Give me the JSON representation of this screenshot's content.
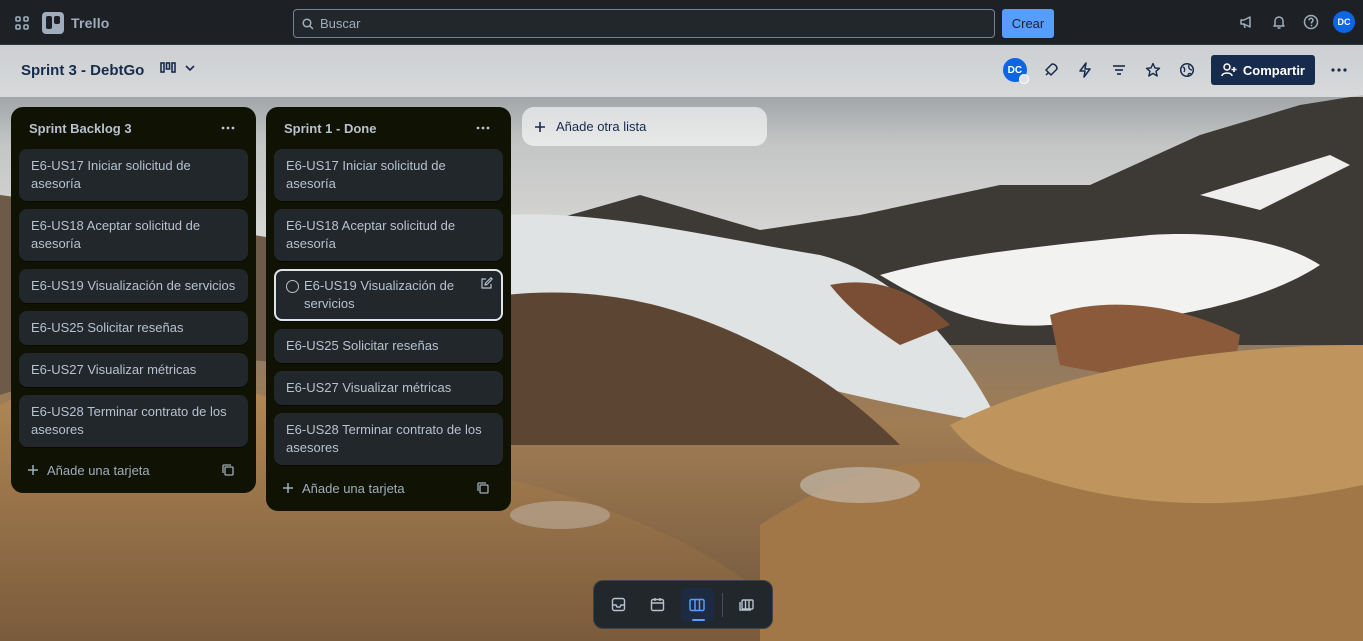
{
  "topbar": {
    "app_name": "Trello",
    "search_placeholder": "Buscar",
    "create_label": "Crear",
    "user_initials": "DC",
    "icons": [
      "apps-grid-icon",
      "megaphone-icon",
      "bell-icon",
      "help-icon"
    ]
  },
  "board": {
    "title": "Sprint 3 - DebtGo",
    "member_initials": "DC",
    "share_label": "Compartir",
    "icons": [
      "board-view-icon",
      "chevron-down-icon",
      "rocket-icon",
      "lightning-icon",
      "filter-icon",
      "star-icon",
      "globe-icon",
      "more-icon"
    ]
  },
  "lists": [
    {
      "title": "Sprint Backlog 3",
      "cards": [
        "E6-US17 Iniciar solicitud de asesoría",
        "E6-US18 Aceptar solicitud de asesoría",
        "E6-US19 Visualización de servicios",
        "E6-US25 Solicitar reseñas",
        "E6-US27 Visualizar métricas",
        "E6-US28 Terminar contrato de los asesores"
      ],
      "add_card_label": "Añade una tarjeta"
    },
    {
      "title": "Sprint 1 - Done",
      "cards": [
        "E6-US17 Iniciar solicitud de asesoría",
        "E6-US18 Aceptar solicitud de asesoría",
        "E6-US19 Visualización de servicios",
        "E6-US25 Solicitar reseñas",
        "E6-US27 Visualizar métricas",
        "E6-US28 Terminar contrato de los asesores"
      ],
      "add_card_label": "Añade una tarjeta"
    }
  ],
  "add_list_label": "Añade otra lista",
  "switcher": {
    "items": [
      "inbox-icon",
      "calendar-icon",
      "board-icon",
      "switch-boards-icon"
    ],
    "active": "board-icon"
  },
  "colors": {
    "accent": "#579dff",
    "topbar": "#1d2125",
    "list_bg": "#101204",
    "card_bg": "#22272b",
    "share_bg": "#172b4d"
  }
}
